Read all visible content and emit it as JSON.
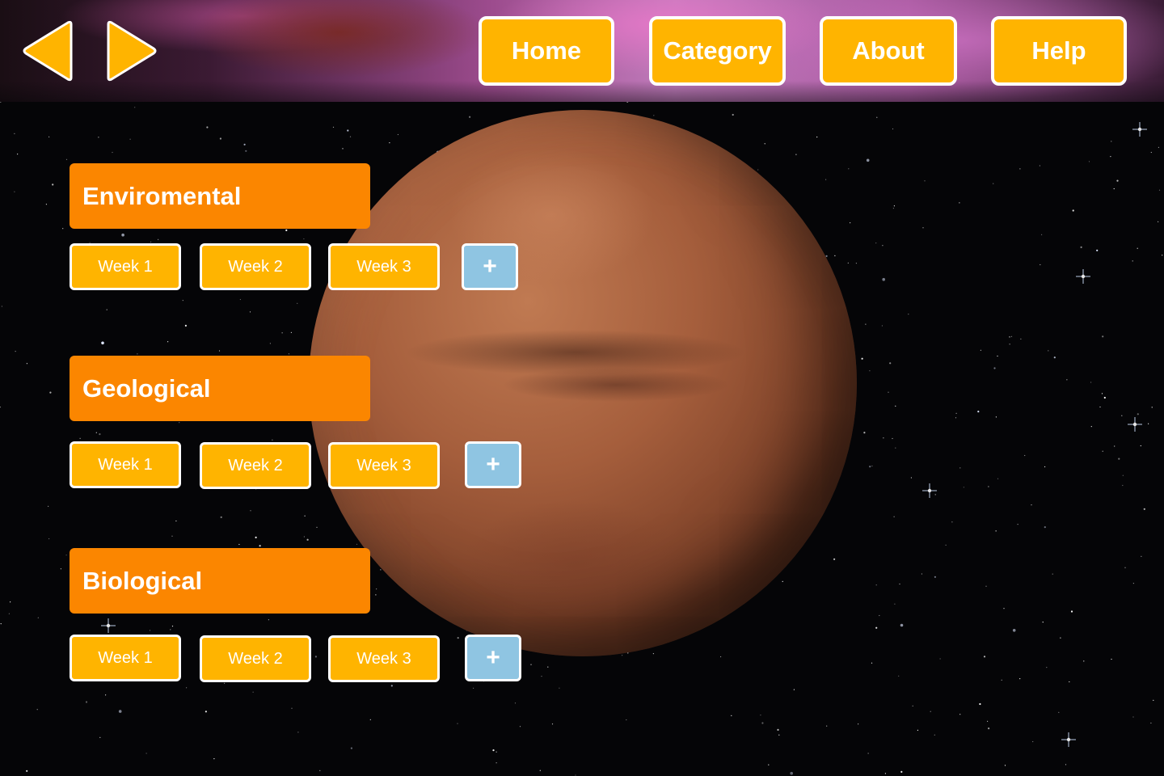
{
  "nav": {
    "home": "Home",
    "category": "Category",
    "about": "About",
    "help": "Help"
  },
  "arrows": {
    "back_icon": "triangle-left-icon",
    "forward_icon": "triangle-right-icon",
    "color": "#ffb400"
  },
  "categories": [
    {
      "title": "Enviromental",
      "weeks": [
        "Week 1",
        "Week 2",
        "Week 3"
      ],
      "add_label": "+"
    },
    {
      "title": "Geological",
      "weeks": [
        "Week 1",
        "Week 2",
        "Week 3"
      ],
      "add_label": "+"
    },
    {
      "title": "Biological",
      "weeks": [
        "Week 1",
        "Week 2",
        "Week 3"
      ],
      "add_label": "+"
    }
  ],
  "colors": {
    "nav_button": "#ffb400",
    "category_header": "#fb8600",
    "week_button": "#ffb400",
    "add_button": "#8fc5e2",
    "border": "#ffffff"
  }
}
